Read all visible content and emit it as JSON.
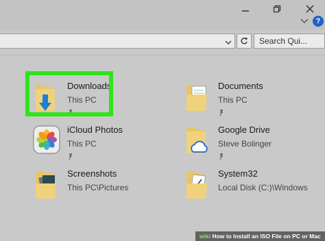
{
  "header": {
    "help_glyph": "?"
  },
  "address": {
    "search_placeholder": "Search Qui..."
  },
  "quick_access": [
    {
      "name": "Downloads",
      "location": "This PC",
      "icon": "downloads-folder-icon",
      "highlighted": true
    },
    {
      "name": "Documents",
      "location": "This PC",
      "icon": "documents-folder-icon"
    },
    {
      "name": "iCloud Photos",
      "location": "This PC",
      "icon": "icloud-photos-icon"
    },
    {
      "name": "Google Drive",
      "location": "Steve Bolinger",
      "icon": "google-drive-folder-icon"
    },
    {
      "name": "Screenshots",
      "location": "This PC\\Pictures",
      "icon": "screenshots-folder-icon"
    },
    {
      "name": "System32",
      "location": "Local Disk (C:)\\Windows",
      "icon": "system32-folder-icon"
    }
  ],
  "footer": {
    "brand": "wiki",
    "caption": "How to Install an ISO File on PC or Mac"
  },
  "colors": {
    "highlight": "#2ee51a",
    "folder": "#e8c56a",
    "accent_blue": "#1e61c7"
  }
}
